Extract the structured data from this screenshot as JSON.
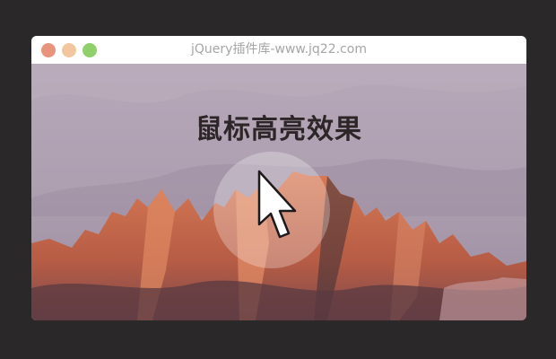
{
  "window": {
    "title": "jQuery插件库-www.jq22.com"
  },
  "hero": {
    "headline": "鼠标高亮效果"
  },
  "icons": {
    "cursor": "mouse-pointer-arrow"
  },
  "colors": {
    "background": "#2a2828",
    "close_button": "#e8937b",
    "minimize_button": "#f3c79d",
    "maximize_button": "#8fd06a",
    "sky": "#b0a3b3",
    "rock": "#c9684a"
  }
}
